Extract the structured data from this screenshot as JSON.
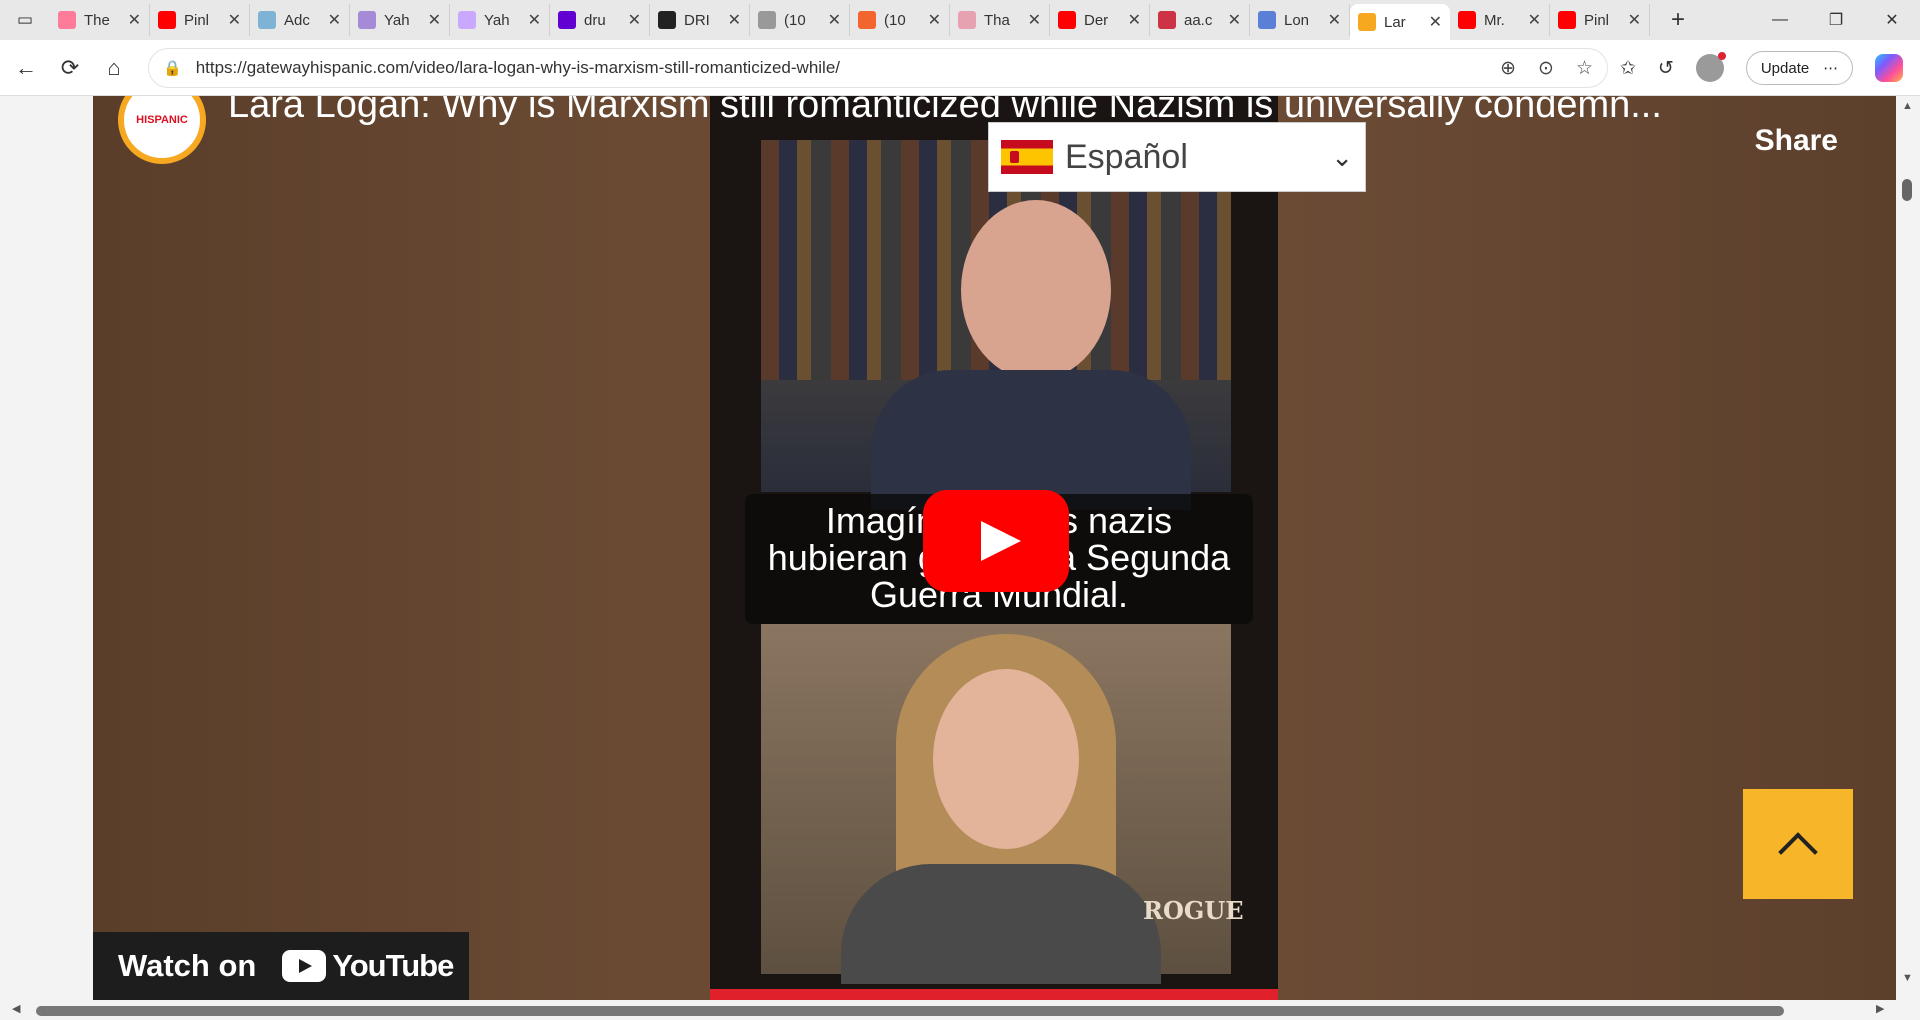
{
  "browser": {
    "tabs": [
      {
        "label": "The",
        "color": "#ff7b9a"
      },
      {
        "label": "Pinl",
        "color": "#ff0000"
      },
      {
        "label": "Adc",
        "color": "#7fb3d5"
      },
      {
        "label": "Yah",
        "color": "#a58ad8"
      },
      {
        "label": "Yah",
        "color": "#c9a8ff"
      },
      {
        "label": "dru",
        "color": "#6001d2"
      },
      {
        "label": "DRI",
        "color": "#222222"
      },
      {
        "label": "(10",
        "color": "#999999"
      },
      {
        "label": "(10",
        "color": "#f2652f"
      },
      {
        "label": "Tha",
        "color": "#e6a2b0"
      },
      {
        "label": "Der",
        "color": "#ff0000"
      },
      {
        "label": "aa.c",
        "color": "#cc3344"
      },
      {
        "label": "Lon",
        "color": "#5a7fd6"
      },
      {
        "label": "Lar",
        "color": "#f6a821",
        "active": true
      },
      {
        "label": "Mr.",
        "color": "#ff0000"
      },
      {
        "label": "Pinl",
        "color": "#ff0000"
      }
    ],
    "url": "https://gatewayhispanic.com/video/lara-logan-why-is-marxism-still-romanticized-while/",
    "update_label": "Update"
  },
  "video": {
    "title": "Lara Logan: Why is Marxism still romanticized while Nazism is universally condemn...",
    "share_label": "Share",
    "channel_logo_text": "HISPANIC",
    "caption_lines": [
      "Imagínate si los nazis",
      "hubieran ganado la Segunda",
      "Guerra Mundial."
    ],
    "watch_on_label": "Watch on",
    "youtube_label": "YouTube",
    "watermark": "ROGUE"
  },
  "language_selector": {
    "selected": "Español"
  }
}
